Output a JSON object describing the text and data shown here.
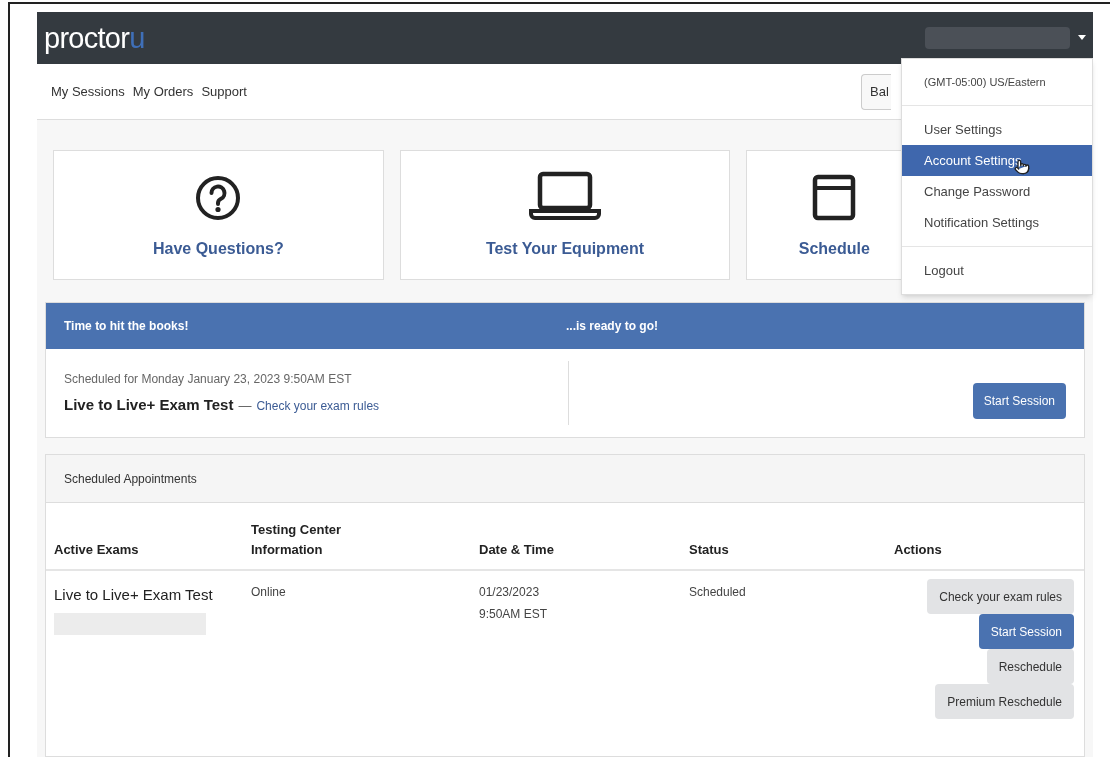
{
  "navbar": {
    "logo": {
      "text": "proctor",
      "accent": "u"
    },
    "user_menu": {
      "expanded": true
    }
  },
  "nav_links": [
    {
      "label": "My Sessions"
    },
    {
      "label": "My Orders"
    },
    {
      "label": "Support"
    }
  ],
  "balance_button": {
    "label": "Bal"
  },
  "user_dropdown": [
    {
      "kind": "info",
      "label": "(GMT-05:00) US/Eastern",
      "selected": false
    },
    {
      "kind": "divider"
    },
    {
      "kind": "item",
      "label": "User Settings",
      "selected": false
    },
    {
      "kind": "item",
      "label": "Account Settings",
      "selected": true
    },
    {
      "kind": "item",
      "label": "Change Password",
      "selected": false
    },
    {
      "kind": "item",
      "label": "Notification Settings",
      "selected": false
    },
    {
      "kind": "divider"
    },
    {
      "kind": "item",
      "label": "Logout",
      "selected": false
    }
  ],
  "cards": [
    {
      "kind": "question",
      "label": "Have Questions?"
    },
    {
      "kind": "laptop",
      "label": "Test Your Equipment"
    },
    {
      "kind": "calendar",
      "label": "Schedule"
    }
  ],
  "upcoming": {
    "header_left": "Time to hit the books!",
    "header_right": "...is ready to go!",
    "scheduled": "Scheduled for Monday January 23, 2023 9:50AM EST",
    "exam": "Live to Live+ Exam Test",
    "separator": "—",
    "rules_link": "Check your exam rules",
    "button": "Start Session"
  },
  "appointments": {
    "title": "Scheduled Appointments",
    "columns": [
      "Active Exams",
      "Testing Center Information",
      "Date & Time",
      "Status",
      "Actions"
    ],
    "rows": [
      {
        "exam": "Live to Live+ Exam Test",
        "location": "Online",
        "date": "01/23/2023",
        "time": "9:50AM EST",
        "status": "Scheduled",
        "actions": [
          {
            "kind": "secondary",
            "label": "Check your exam rules"
          },
          {
            "kind": "primary",
            "label": "Start Session"
          },
          {
            "kind": "secondary",
            "label": "Reschedule"
          },
          {
            "kind": "secondary",
            "label": "Premium Reschedule"
          }
        ]
      }
    ]
  }
}
